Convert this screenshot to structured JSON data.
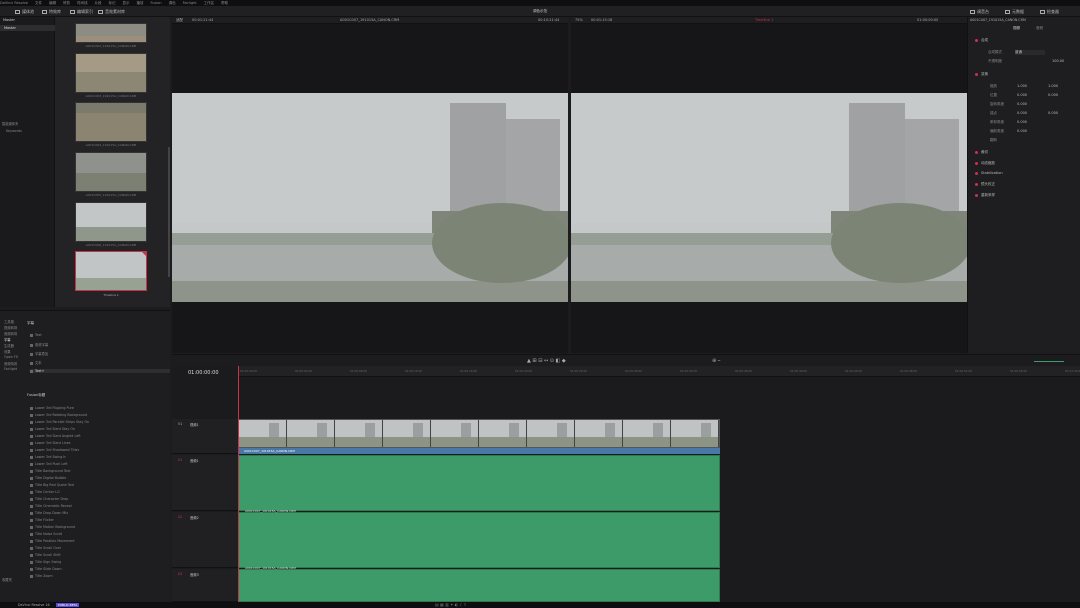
{
  "menu": [
    "DaVinci Resolve",
    "文件",
    "编辑",
    "修剪",
    "时间线",
    "片段",
    "标记",
    "显示",
    "播放",
    "Fusion",
    "调色",
    "Fairlight",
    "工作区",
    "帮助"
  ],
  "app_title": "调色示范",
  "toolbar": {
    "media_pool": "媒体池",
    "effects_library": "特效库",
    "edit_index": "编辑索引",
    "sound_library": "音效素材库",
    "mixer": "调音台",
    "metadata": "元数据",
    "inspector": "检查器"
  },
  "media_pool": {
    "bin_header": "Master",
    "sidebar_items": [
      "Master"
    ],
    "smart_bins_label": "智能媒体夹",
    "smart_bins_item": "Keywords",
    "clips": [
      {
        "label": "A001C002_191015A_CANON.CRM"
      },
      {
        "label": "A001C003_191015A_CANON.CRM"
      },
      {
        "label": "A001C004_191015A_CANON.CRM"
      },
      {
        "label": "A001C005_191015A_CANON.CRM"
      },
      {
        "label": "A001C006_191015A_CANON.CRM"
      },
      {
        "label": "Timeline 1"
      }
    ]
  },
  "source_viewer": {
    "zoom": "适配",
    "timecode_in": "00:01:21:44",
    "clip_name": "A001C007_191015A_CANON.CRM",
    "timecode_out": "00:10:21:44"
  },
  "timeline_viewer": {
    "zoom": "75%",
    "timecode": "00:01:15:18",
    "timeline_name": "Timeline 1",
    "timecode_right": "01:00:00:00"
  },
  "inspector": {
    "clip_name": "A001C007_191015A_CANON.CRM",
    "tabs": [
      "视频",
      "音频"
    ],
    "sections": [
      "合成",
      "变换",
      "裁切",
      "动态缩放",
      "Stabilization",
      "镜头校正",
      "重新采样"
    ],
    "composite_mode_label": "合成模式",
    "composite_mode_value": "普通",
    "opacity_label": "不透明度",
    "opacity_value": "100.00",
    "transform_rows": [
      {
        "label": "缩放",
        "x": "1.000",
        "y": "1.000"
      },
      {
        "label": "位置",
        "x": "0.000",
        "y": "0.000"
      },
      {
        "label": "旋转角度",
        "x": "0.000",
        "y": ""
      },
      {
        "label": "锚点",
        "x": "0.000",
        "y": "0.000"
      },
      {
        "label": "俯仰角度",
        "x": "0.000",
        "y": ""
      },
      {
        "label": "偏航角度",
        "x": "0.000",
        "y": ""
      },
      {
        "label": "翻转",
        "x": "",
        "y": ""
      }
    ]
  },
  "effects_library": {
    "left_tree": [
      "工具箱",
      "视频转场",
      "音频转场",
      "字幕",
      "生成器",
      "效果",
      "Open FX",
      "音频特效",
      "Fairlight"
    ],
    "section_title": "字幕",
    "items": [
      "Text",
      "卷滚字幕",
      "字幕叠加",
      "文本",
      "Text+"
    ],
    "fusion_title": "Fusion标题",
    "fusion_items": [
      "Lower 3rd Flipping Pure",
      "Lower 3rd Rotating Background",
      "Lower 3rd Parallel Strips Stay On",
      "Lower 3rd Slant Stay On",
      "Lower 3rd Slant Angled Left",
      "Lower 3rd Slant Lines",
      "Lower 3rd Shadowed Titles",
      "Lower 3rd Swing In",
      "Lower 3rd Push Left",
      "Title Background Text",
      "Title Digital Bubble",
      "Title Big Red Quote Text",
      "Title Center LG",
      "Title Character Drop",
      "Title Cinematic Reveal",
      "Title Drop Down Mix",
      "Title Flicker",
      "Title Motion Background",
      "Title Noise Scroll",
      "Title Parallax Movement",
      "Title Scroll Over",
      "Title Scroll Shift",
      "Title Sign Swing",
      "Title Slide Down",
      "Title Zoom"
    ],
    "favorites_label": "收藏夹"
  },
  "timeline": {
    "timecode": "01:00:00:00",
    "ruler_ticks": [
      "01:00:00:00",
      "01:00:04:00",
      "01:00:08:00",
      "01:00:12:00",
      "01:00:16:00",
      "01:00:20:00",
      "01:00:24:00",
      "01:00:28:00",
      "01:00:32:00",
      "01:00:36:00",
      "01:00:40:00",
      "01:00:44:00",
      "01:00:48:00",
      "01:00:52:00",
      "01:00:56:00",
      "01:01:00:00"
    ],
    "tracks": [
      {
        "id": "V1",
        "name": "视频1",
        "clip": "A001C007_191015A_CANON.CRM"
      },
      {
        "id": "A1",
        "name": "音频1",
        "clip": ""
      },
      {
        "id": "A2",
        "name": "音频2",
        "clip": "A001C007_191015A_CANON.CRM"
      },
      {
        "id": "A3",
        "name": "音频3",
        "clip": "A001C007_191015A_CANON.CRM"
      }
    ]
  },
  "status": {
    "app_name": "DaVinci Resolve 16",
    "badge": "PUBLIC BETA"
  },
  "colors": {
    "accent_red": "#c8324a",
    "audio_clip": "#3d9b6a",
    "video_clip_bar": "#4a78a6",
    "panel_bg": "#1e1e20"
  }
}
